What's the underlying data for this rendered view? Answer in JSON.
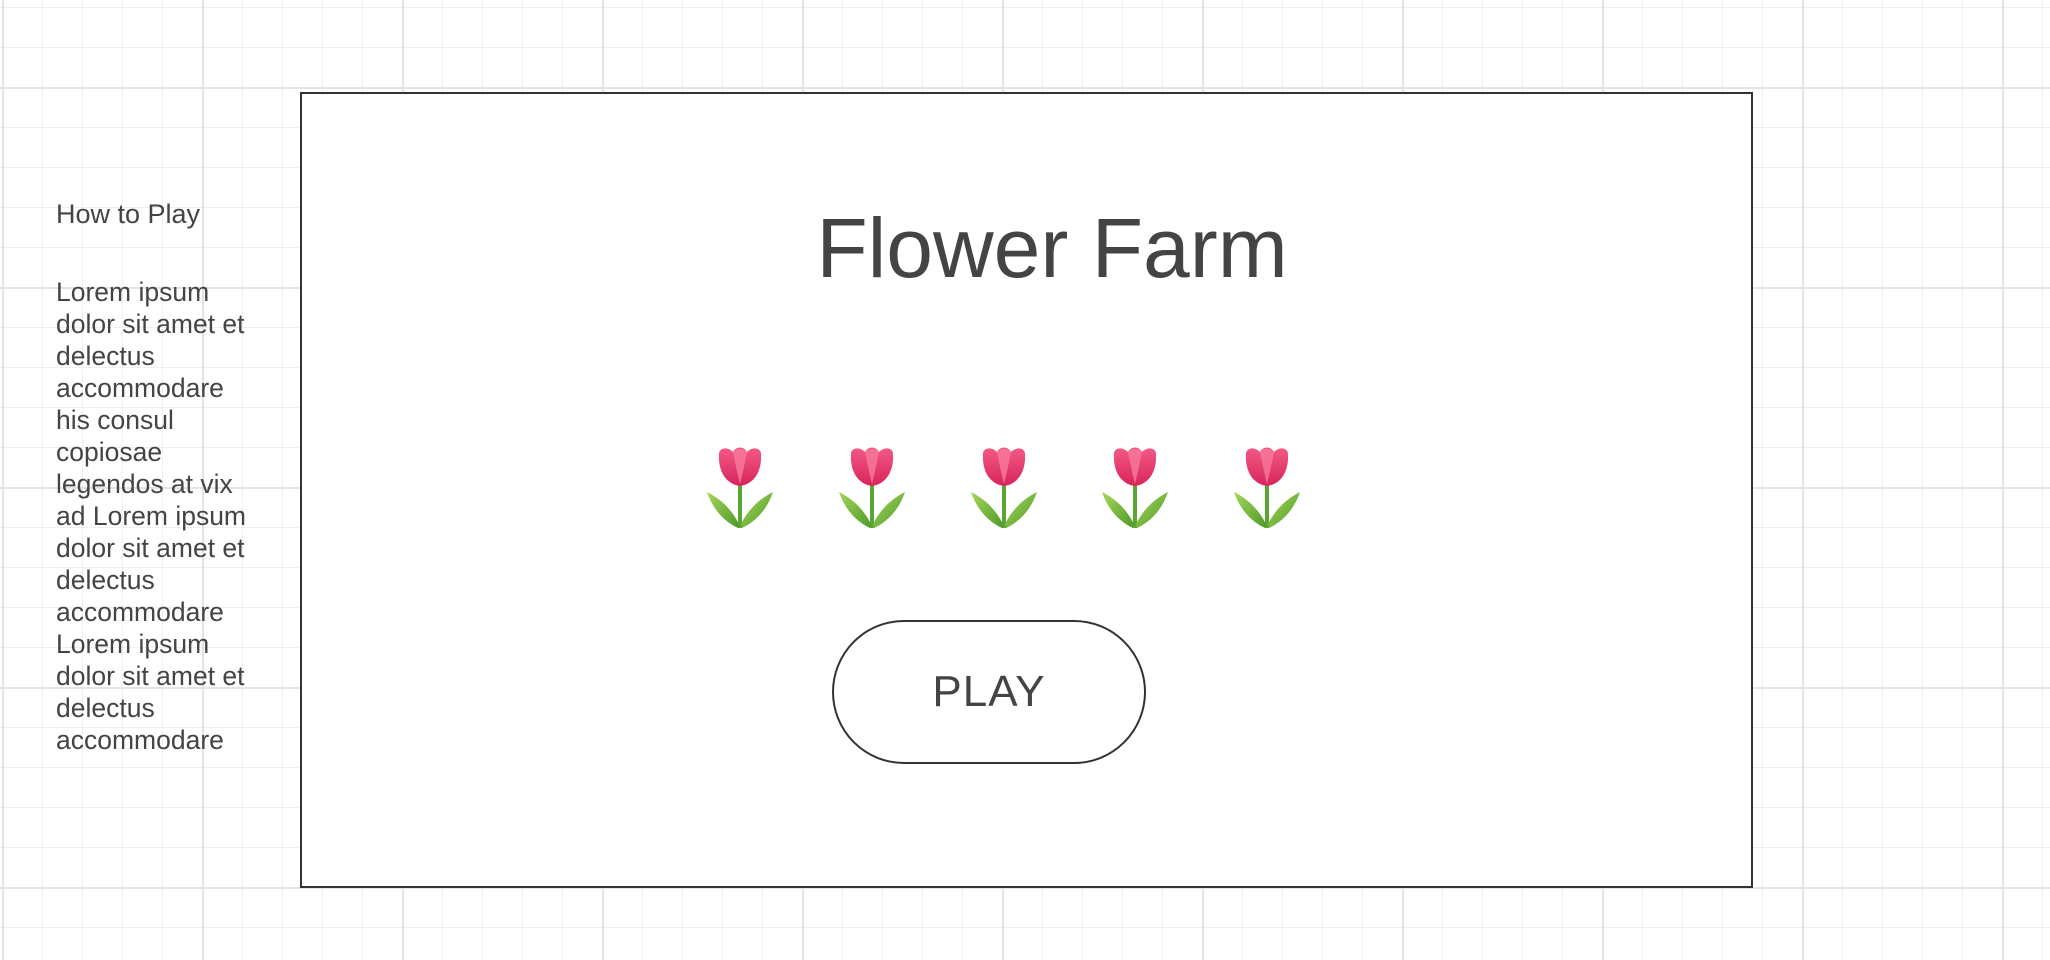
{
  "sidebar": {
    "title": "How to Play",
    "text": "Lorem ipsum dolor sit amet et delectus accommodare his consul copiosae legendos at vix ad Lorem ipsum dolor sit amet et delectus accommodare Lorem ipsum dolor sit amet et delectus accommodare"
  },
  "game": {
    "title": "Flower Farm",
    "flower_icon": "tulip-icon",
    "flower_count": 5,
    "play_label": "PLAY"
  },
  "colors": {
    "text": "#444444",
    "border": "#333333",
    "petal": "#e8336b",
    "leaf": "#6cbf3a"
  }
}
